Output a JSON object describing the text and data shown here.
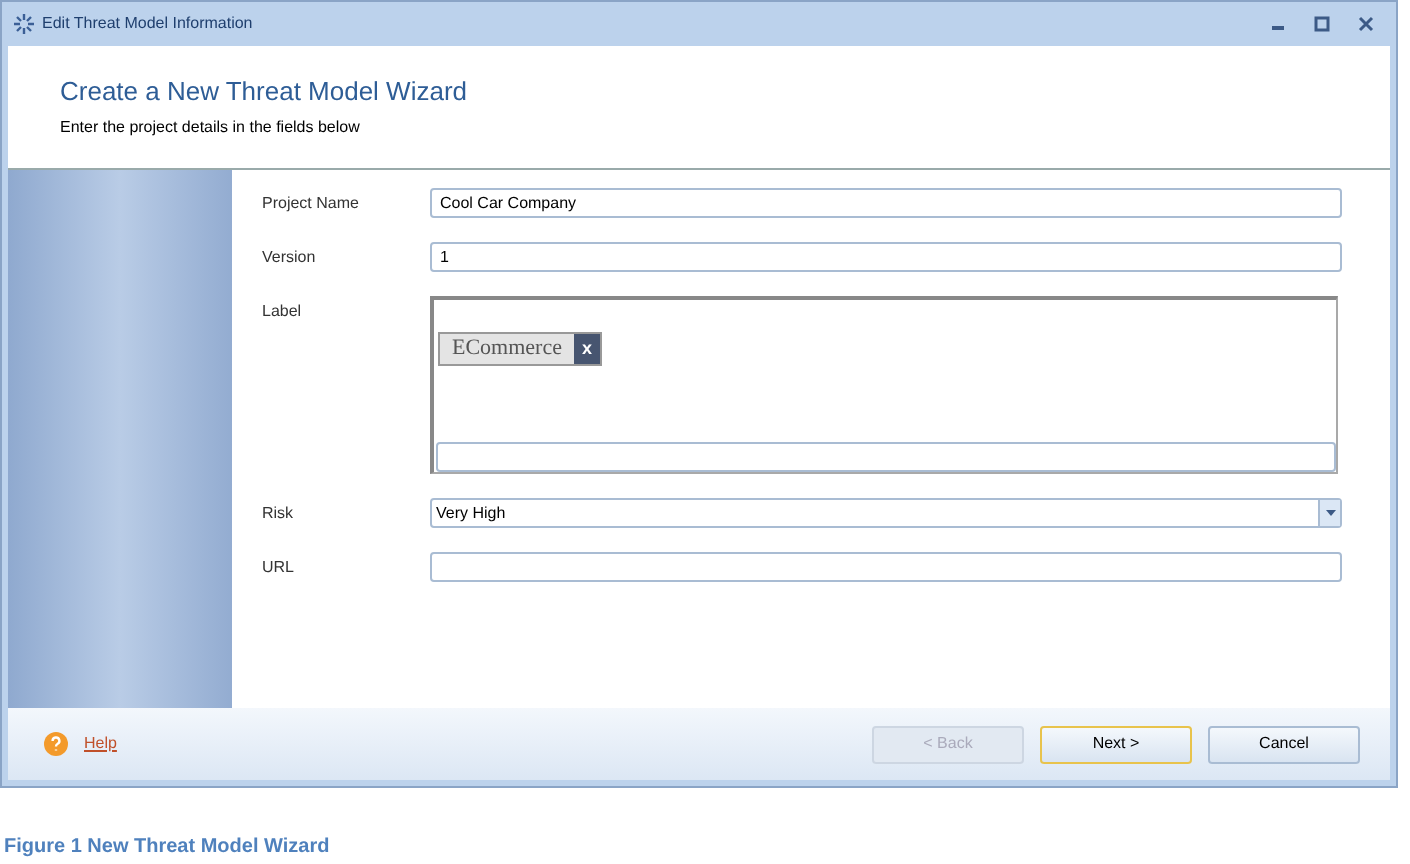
{
  "window": {
    "title": "Edit Threat Model Information"
  },
  "header": {
    "title": "Create a New Threat Model Wizard",
    "subtitle": "Enter the project details in the fields below"
  },
  "fields": [
    {
      "kind": "text",
      "label": "Project Name",
      "value": "Cool Car Company"
    },
    {
      "kind": "text",
      "label": "Version",
      "value": "1"
    },
    {
      "kind": "tags",
      "label": "Label",
      "tags": [
        {
          "text": "ECommerce",
          "remove": "x"
        }
      ]
    },
    {
      "kind": "select",
      "label": "Risk",
      "value": "Very High"
    },
    {
      "kind": "text",
      "label": "URL"
    }
  ],
  "footer": {
    "help": "Help",
    "buttons": [
      {
        "label": "<  Back",
        "disabled": true,
        "selected": false
      },
      {
        "label": "Next  >",
        "disabled": false,
        "selected": true
      },
      {
        "label": "Cancel",
        "disabled": false,
        "selected": false
      }
    ]
  },
  "caption": "Figure 1 New Threat Model Wizard"
}
